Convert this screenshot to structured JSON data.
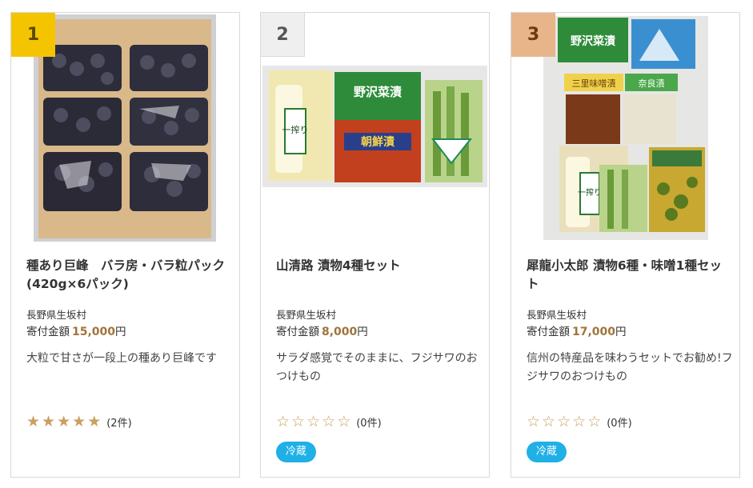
{
  "colors": {
    "rank1": "#f5c400",
    "rank2": "#efefef",
    "rank3": "#e8b48a",
    "price": "#a0743c",
    "star_filled": "#c8a060",
    "star_empty": "#c8a060",
    "badge": "#1fb0e6"
  },
  "cards": [
    {
      "rank": "1",
      "title": "種あり巨峰　バラ房・バラ粒パック(420g×6パック)",
      "municipality": "長野県生坂村",
      "price_label": "寄付金額",
      "price": "15,000",
      "yen": "円",
      "description": "大粒で甘さが一段上の種あり巨峰です",
      "rating_stars": 5,
      "review_count": "(2件)",
      "badge": ""
    },
    {
      "rank": "2",
      "title": "山清路 漬物4種セット",
      "municipality": "長野県生坂村",
      "price_label": "寄付金額",
      "price": "8,000",
      "yen": "円",
      "description": "サラダ感覚でそのままに、フジサワのおつけもの",
      "rating_stars": 0,
      "review_count": "(0件)",
      "badge": "冷蔵",
      "package_labels": [
        "一搾り",
        "野沢菜漬",
        "朝鮮漬"
      ]
    },
    {
      "rank": "3",
      "title": "犀龍小太郎 漬物6種・味噌1種セット",
      "municipality": "長野県生坂村",
      "price_label": "寄付金額",
      "price": "17,000",
      "yen": "円",
      "description": "信州の特産品を味わうセットでお勧め!フジサワのおつけもの",
      "rating_stars": 0,
      "review_count": "(0件)",
      "badge": "冷蔵",
      "package_labels": [
        "野沢菜漬",
        "三里味噌漬",
        "奈良漬",
        "一搾り"
      ]
    }
  ]
}
